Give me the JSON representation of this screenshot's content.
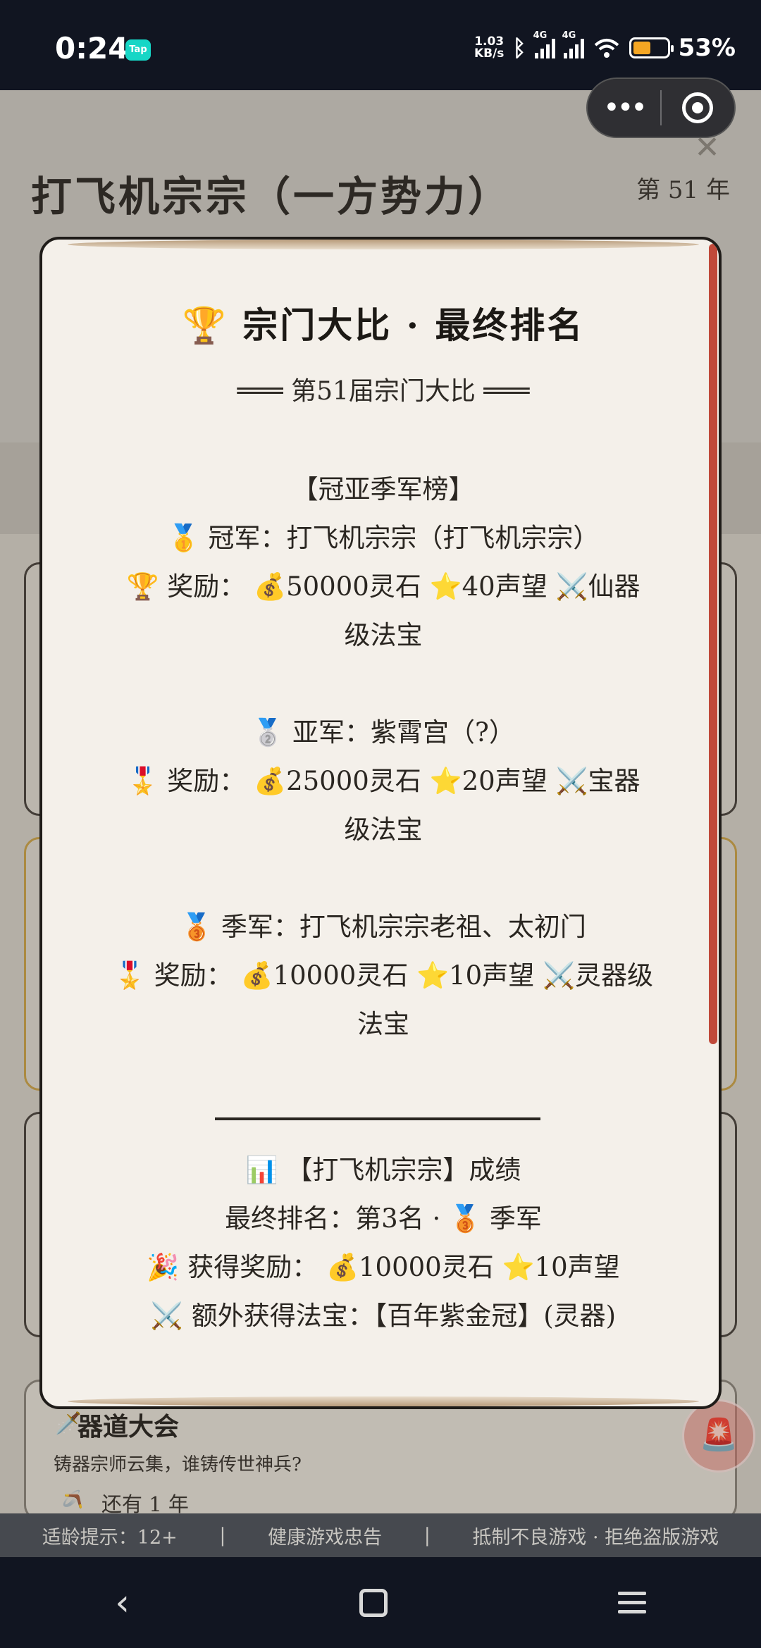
{
  "status": {
    "time": "0:24",
    "tap_badge": "Tap",
    "net_speed_value": "1.03",
    "net_speed_unit": "KB/s",
    "signal_label_1": "4G",
    "signal_label_2": "4G",
    "battery_text": "53%",
    "battery_level": 0.53
  },
  "mini_program": {
    "menu_icon": "more-dots-icon",
    "close_icon": "target-icon"
  },
  "background": {
    "sect_title": "打飞机宗宗（一方势力）",
    "year_label": "第 51 年",
    "close_glyph": "✕",
    "contest": {
      "icon": "🗡️",
      "name": "器道大会",
      "desc": "铸器宗师云集，谁铸传世神兵?",
      "remain_icon": "🪃",
      "remain": "还有 1 年"
    },
    "fab_icon": "🚨",
    "footer": [
      "适龄提示：12+",
      "|",
      "健康游戏忠告",
      "|",
      "抵制不良游戏 · 拒绝盗版游戏"
    ]
  },
  "modal": {
    "title": "🏆  宗门大比 · 最终排名",
    "subtitle": "═══ 第51届宗门大比 ═══",
    "podium_header": "【冠亚季军榜】",
    "champion": "🥇 冠军：打飞机宗宗（打飞机宗宗）",
    "champion_reward_1": "🏆 奖励： 💰50000灵石 ⭐40声望 ⚔️仙器",
    "champion_reward_2": "级法宝",
    "runner_up": "🥈 亚军：紫霄宫（?）",
    "runner_up_reward_1": "🎖️ 奖励： 💰25000灵石 ⭐20声望 ⚔️宝器",
    "runner_up_reward_2": "级法宝",
    "third": "🥉 季军：打飞机宗宗老祖、太初门",
    "third_reward_1": "🎖️ 奖励： 💰10000灵石 ⭐10声望 ⚔️灵器级",
    "third_reward_2": "法宝",
    "result_header": "📊 【打飞机宗宗】成绩",
    "final_rank": "最终排名：第3名 · 🥉 季军",
    "gained_reward": "🎉 获得奖励： 💰10000灵石 ⭐10声望",
    "extra_treasure": "⚔️ 额外获得法宝：【百年紫金冠】(灵器)"
  },
  "nav": {
    "back_glyph": "‹"
  }
}
